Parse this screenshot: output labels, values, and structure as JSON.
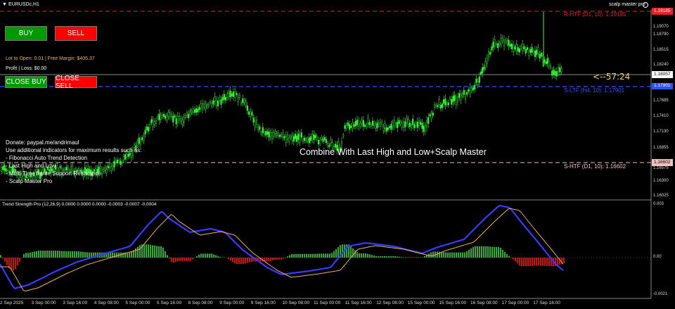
{
  "window": {
    "symbol_tab": "EURUSDc,H1",
    "indicator_brand": "scalp master pro"
  },
  "colors": {
    "buy": "#009900",
    "sell": "#ff0000",
    "candle": "#33ff33",
    "htf_red": "#e8212a",
    "htf_blue": "#2a55ff",
    "htf_pink": "#f2c0c0",
    "osc_blue": "#3a3aff",
    "osc_orange": "#e6b066",
    "hist_up": "#33aa33",
    "hist_down": "#cc1111"
  },
  "trade_panel": {
    "buy_label": "BUY",
    "sell_label": "SELL",
    "lot_line": "Lot to Open: 0.01 | Free Margin: $405.37",
    "profit_line": "Profit | Loss: $0.00",
    "close_buy_label": "CLOSE BUY",
    "close_sell_label": "CLOSE SELL"
  },
  "info_text": {
    "lines": [
      "Donate: paypal.me/andrimaul",
      "Use additional indicators for maximum results such as:",
      "- Fibonacci Auto Trend Detection",
      "- Last High and Low",
      "- Multi Time frame Support Resistance",
      "- Scalp Master Pro"
    ]
  },
  "chart_title": "Combine With Last High and Low+Scalp Master",
  "countdown": "<--57:24",
  "levels": {
    "r_htf": "R-HTF (D1, 10): 1.19185",
    "s_ltf": "S-LTF (H4, 10): 1.17901",
    "s_htf": "S-HTF (D1, 10): 1.16602"
  },
  "price_axis": {
    "labels": [
      "1.19185",
      "1.19070",
      "1.18790",
      "1.18515",
      "1.18240",
      "1.18057",
      "1.17960",
      "1.17685",
      "1.17410",
      "1.17130",
      "1.16855",
      "1.16602",
      "1.16575",
      "1.16300",
      "1.16025"
    ],
    "current_price": "1.18057",
    "r_htf_tag": "1.19185",
    "s_ltf_tag": "1.17901",
    "s_htf_tag": "1.16602"
  },
  "oscillator": {
    "title": "Trend Strength Pro (12,26,9) 0.0000 0.0000 0.0000 -0.0003 -0.0007 -0.0004",
    "axis_labels": [
      "0.003",
      "0.00",
      "-0.0021"
    ]
  },
  "time_axis": {
    "labels": [
      "2 Sep 2025",
      "3 Sep 00:00",
      "3 Sep 16:00",
      "4 Sep 08:00",
      "5 Sep 00:00",
      "5 Sep 16:00",
      "8 Sep 08:00",
      "9 Sep 00:00",
      "9 Sep 16:00",
      "10 Sep 08:00",
      "11 Sep 00:00",
      "11 Sep 16:00",
      "12 Sep 08:00",
      "15 Sep 00:00",
      "15 Sep 16:00",
      "16 Sep 08:00",
      "17 Sep 00:00",
      "17 Sep 16:00"
    ]
  }
}
